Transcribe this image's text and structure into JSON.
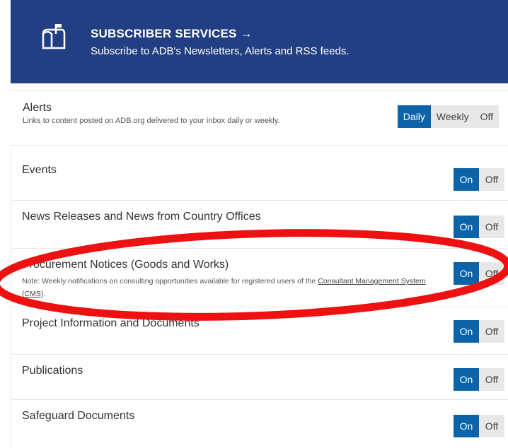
{
  "banner": {
    "title": "SUBSCRIBER SERVICES →",
    "subtitle": "Subscribe to ADB's Newsletters, Alerts and RSS feeds."
  },
  "alerts": {
    "label": "Alerts",
    "description": "Links to content posted on ADB.org delivered to your inbox daily or weekly.",
    "options": [
      "Daily",
      "Weekly",
      "Off"
    ],
    "selected": "Daily"
  },
  "toggle_labels": {
    "on": "On",
    "off": "Off"
  },
  "rows": [
    {
      "label": "Events",
      "state": "On"
    },
    {
      "label": "News Releases and News from Country Offices",
      "state": "On"
    },
    {
      "label": "Procurement Notices (Goods and Works)",
      "state": "On",
      "note_prefix": "Note: Weekly notifications on consulting opportunities available for registered users of the ",
      "note_link": "Consultant Management System (CMS)",
      "note_suffix": "."
    },
    {
      "label": "Project Information and Documents",
      "state": "On"
    },
    {
      "label": "Publications",
      "state": "On"
    },
    {
      "label": "Safeguard Documents",
      "state": "On"
    }
  ],
  "colors": {
    "banner": "#233f83",
    "accent": "#0b64a9",
    "annotation": "#ee1111"
  }
}
